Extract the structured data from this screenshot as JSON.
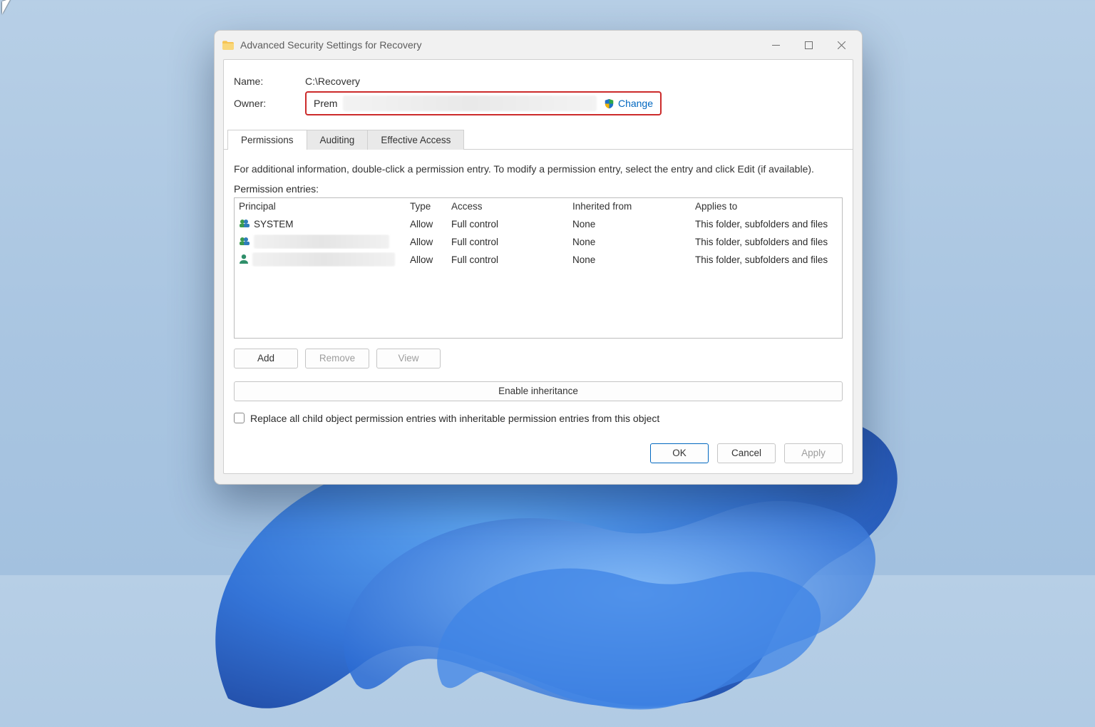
{
  "titlebar": {
    "title": "Advanced Security Settings for Recovery"
  },
  "labels": {
    "name": "Name:",
    "owner": "Owner:",
    "info": "For additional information, double-click a permission entry. To modify a permission entry, select the entry and click Edit (if available).",
    "entries": "Permission entries:"
  },
  "values": {
    "name": "C:\\Recovery",
    "owner_display": "Prem",
    "change": "Change"
  },
  "tabs": [
    {
      "label": "Permissions",
      "active": true
    },
    {
      "label": "Auditing",
      "active": false
    },
    {
      "label": "Effective Access",
      "active": false
    }
  ],
  "grid": {
    "headers": {
      "principal": "Principal",
      "type": "Type",
      "access": "Access",
      "inherited": "Inherited from",
      "applies": "Applies to"
    },
    "rows": [
      {
        "icon": "group",
        "principal": "SYSTEM",
        "redacted": false,
        "type": "Allow",
        "access": "Full control",
        "inherited": "None",
        "applies": "This folder, subfolders and files"
      },
      {
        "icon": "group",
        "principal": "",
        "redacted": true,
        "type": "Allow",
        "access": "Full control",
        "inherited": "None",
        "applies": "This folder, subfolders and files"
      },
      {
        "icon": "user",
        "principal": "",
        "redacted": true,
        "type": "Allow",
        "access": "Full control",
        "inherited": "None",
        "applies": "This folder, subfolders and files"
      }
    ]
  },
  "buttons": {
    "add": "Add",
    "remove": "Remove",
    "view": "View",
    "enable_inheritance": "Enable inheritance",
    "ok": "OK",
    "cancel": "Cancel",
    "apply": "Apply"
  },
  "checkbox": {
    "replace_children": "Replace all child object permission entries with inheritable permission entries from this object"
  }
}
